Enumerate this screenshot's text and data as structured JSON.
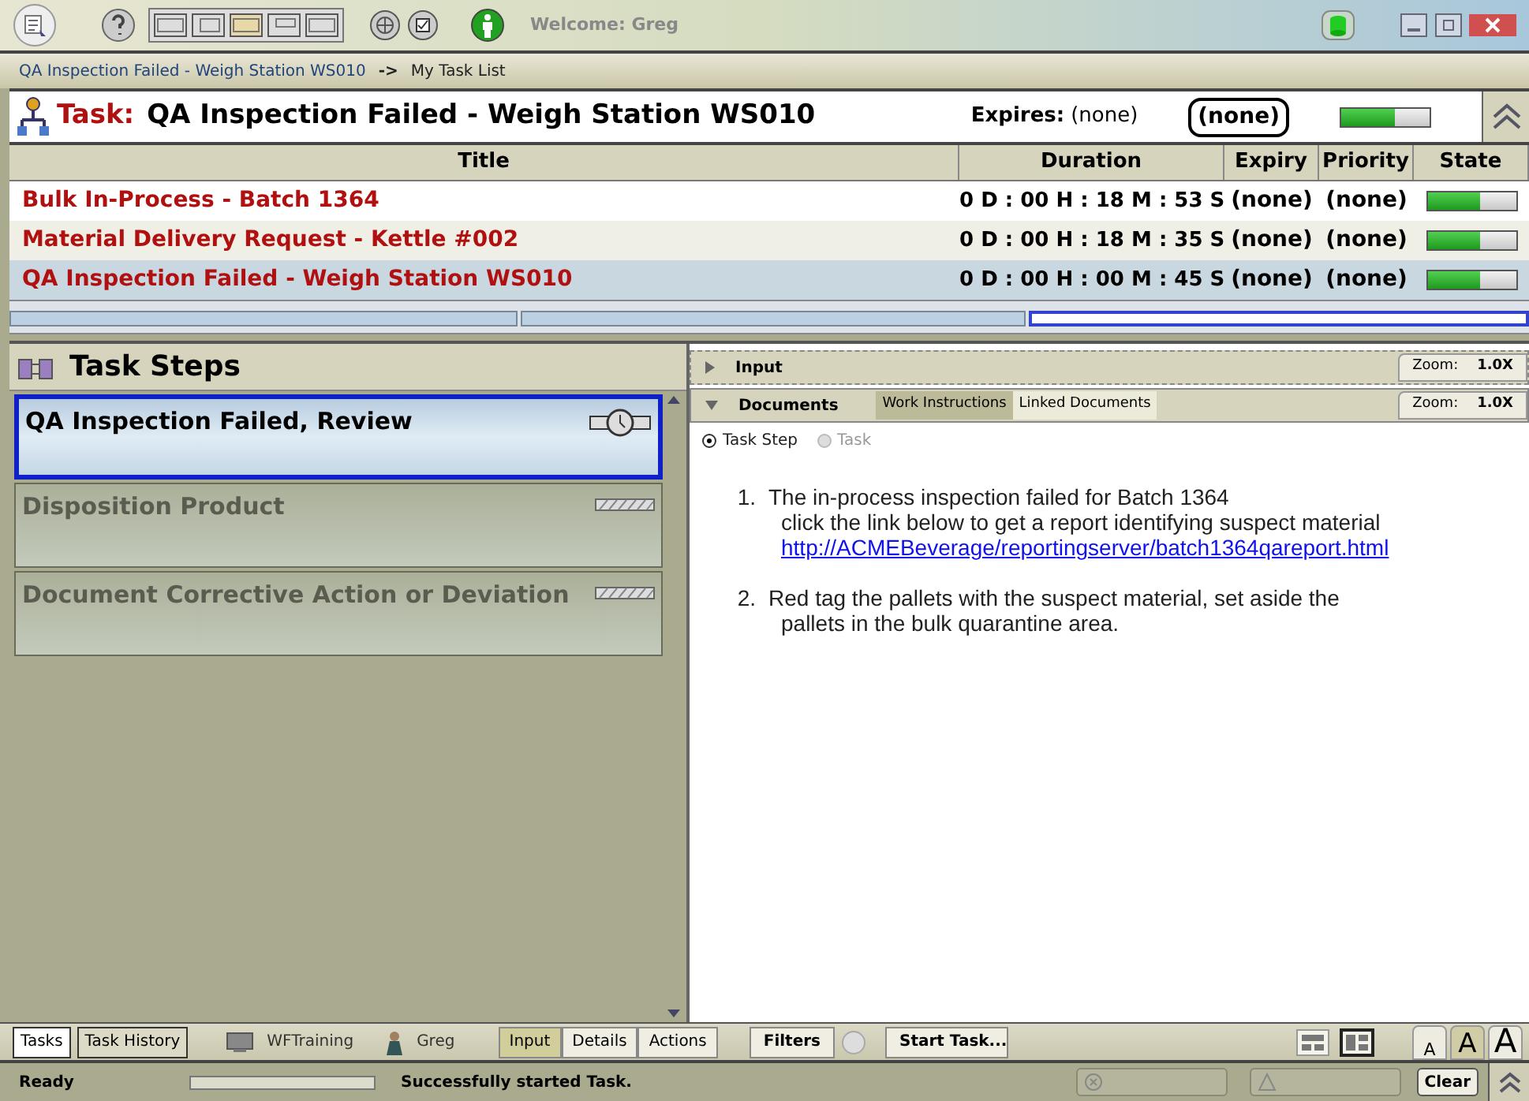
{
  "toolbar": {
    "welcome": "Welcome: Greg"
  },
  "breadcrumb": {
    "link": "QA Inspection Failed - Weigh Station WS010",
    "separator": "->",
    "current": "My Task List"
  },
  "task_header": {
    "label": "Task:",
    "title": "QA Inspection Failed - Weigh Station WS010",
    "expires_label": "Expires:",
    "expires_value": "(none)",
    "priority": "(none)",
    "level": 0.6
  },
  "table": {
    "columns": [
      "Title",
      "Duration",
      "Expiry",
      "Priority",
      "State"
    ],
    "rows": [
      {
        "title": "Bulk In-Process - Batch 1364",
        "duration": "0 D : 00 H : 18 M : 53 S",
        "expiry": "(none)",
        "priority": "(none)",
        "level": 0.6,
        "selected": false
      },
      {
        "title": "Material Delivery Request - Kettle #002",
        "duration": "0 D : 00 H : 18 M : 35 S",
        "expiry": "(none)",
        "priority": "(none)",
        "level": 0.6,
        "selected": false
      },
      {
        "title": "QA Inspection Failed - Weigh Station WS010",
        "duration": "0 D : 00 H : 00 M : 45 S",
        "expiry": "(none)",
        "priority": "(none)",
        "level": 0.6,
        "selected": true
      }
    ]
  },
  "task_steps": {
    "title": "Task Steps",
    "steps": [
      {
        "name": "QA Inspection Failed, Review",
        "selected": true,
        "kind": "active"
      },
      {
        "name": "Disposition Product",
        "selected": false,
        "kind": "pending"
      },
      {
        "name": "Document Corrective Action or Deviation",
        "selected": false,
        "kind": "pending"
      }
    ]
  },
  "input_section": {
    "title": "Input",
    "expanded": false,
    "zoom_label": "Zoom:",
    "zoom_value": "1.0X"
  },
  "documents_section": {
    "title": "Documents",
    "expanded": true,
    "zoom_label": "Zoom:",
    "zoom_value": "1.0X",
    "tabs": [
      {
        "label": "Work Instructions",
        "selected": true
      },
      {
        "label": "Linked Documents",
        "selected": false
      }
    ],
    "scope_options": [
      {
        "label": "Task Step",
        "selected": true,
        "disabled": false
      },
      {
        "label": "Task",
        "selected": false,
        "disabled": true
      }
    ],
    "instructions": [
      {
        "number": "1.",
        "lines": [
          "The in-process inspection failed for Batch 1364",
          "click the link below to get a report identifying suspect material"
        ],
        "link": "http://ACMEBeverage/reportingserver/batch1364qareport.html"
      },
      {
        "number": "2.",
        "lines": [
          "Red tag the pallets with the suspect material, set aside the",
          "pallets in the bulk quarantine area."
        ]
      }
    ]
  },
  "bottom_bar": {
    "tabs": [
      {
        "label": "Tasks",
        "selected": true
      },
      {
        "label": "Task History",
        "selected": false
      }
    ],
    "workstation": "WFTraining",
    "user": "Greg",
    "panel_buttons": [
      {
        "label": "Input",
        "selected": true
      },
      {
        "label": "Details",
        "selected": false
      },
      {
        "label": "Actions",
        "selected": false
      }
    ],
    "filters_button": "Filters",
    "start_task_button": "Start Task...",
    "layouts": [
      {
        "selected": false
      },
      {
        "selected": true
      }
    ],
    "font_sizes": [
      {
        "label": "A",
        "selected": false
      },
      {
        "label": "A",
        "selected": true
      },
      {
        "label": "A",
        "selected": false
      }
    ]
  },
  "status_bar": {
    "status": "Ready",
    "level": 0,
    "message": "Successfully started Task.",
    "clear_button": "Clear"
  }
}
